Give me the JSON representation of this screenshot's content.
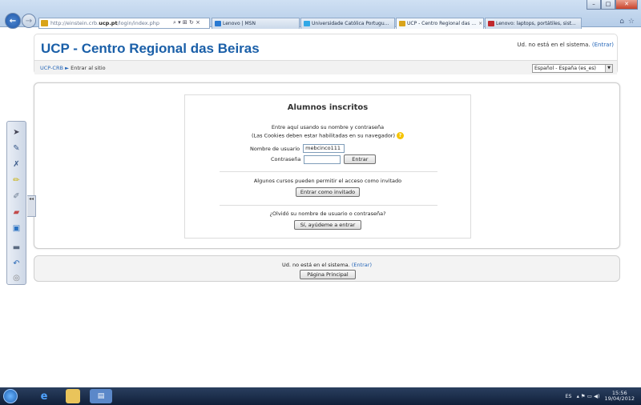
{
  "browser": {
    "url_prefix": "http://einstein.crb.",
    "url_domain": "ucp.pt",
    "url_path": "/login/index.php",
    "address_icons": "⌕ ▾ ⊞ ↻ ×",
    "tabs": [
      {
        "label": "Lenovo | MSN",
        "color": "#2a7ad2"
      },
      {
        "label": "Universidade Católica Portugu...",
        "color": "#31a8e6"
      },
      {
        "label": "UCP - Centro Regional das ...",
        "color": "#d9a41a",
        "close": "×"
      },
      {
        "label": "Lenovo: laptops, portátiles, sist...",
        "color": "#c0282d"
      }
    ],
    "tools": [
      "⌂",
      "☆"
    ]
  },
  "header": {
    "site_title": "UCP - Centro Regional das Beiras",
    "not_logged_text": "Ud. no está en el sistema.",
    "login_link": "(Entrar)",
    "breadcrumb_home": "UCP-CRB",
    "breadcrumb_sep": "►",
    "breadcrumb_current": "Entrar al sitio",
    "language_selected": "Español - España (es_es)"
  },
  "login": {
    "title": "Alumnos inscritos",
    "intro_line1": "Entre aquí usando su nombre y contraseña",
    "intro_line2": "(Las Cookies deben estar habilitadas en su navegador)",
    "username_label": "Nombre de usuario",
    "username_value": "mebcinco111",
    "password_label": "Contraseña",
    "password_value": "",
    "submit_label": "Entrar",
    "guest_text": "Algunos cursos pueden permitir el acceso como invitado",
    "guest_button": "Entrar como invitado",
    "forgot_text": "¿Olvidó su nombre de usuario o contraseña?",
    "forgot_button": "Sí, ayúdeme a entrar"
  },
  "footer": {
    "not_logged_text": "Ud. no está en el sistema.",
    "login_link": "(Entrar)",
    "home_button": "Página Principal"
  },
  "pen_toolbar": {
    "tools": [
      "cursor-icon",
      "pen-icon",
      "pen-x-icon",
      "highlighter-icon",
      "marker-icon",
      "eraser-icon",
      "page-icon",
      "line-icon",
      "undo-icon",
      "settings-icon"
    ],
    "handle": "◂◂"
  },
  "taskbar": {
    "apps": [
      "ie-icon",
      "explorer-icon",
      "presentation-icon"
    ],
    "lang": "ES",
    "tray_icons": "▴ ⚑ ▭ ◀)",
    "time": "15:56",
    "date": "19/04/2012"
  },
  "colors": {
    "brand_blue": "#1a5fa8",
    "link_blue": "#2566b8",
    "help_yellow": "#f5c400"
  }
}
